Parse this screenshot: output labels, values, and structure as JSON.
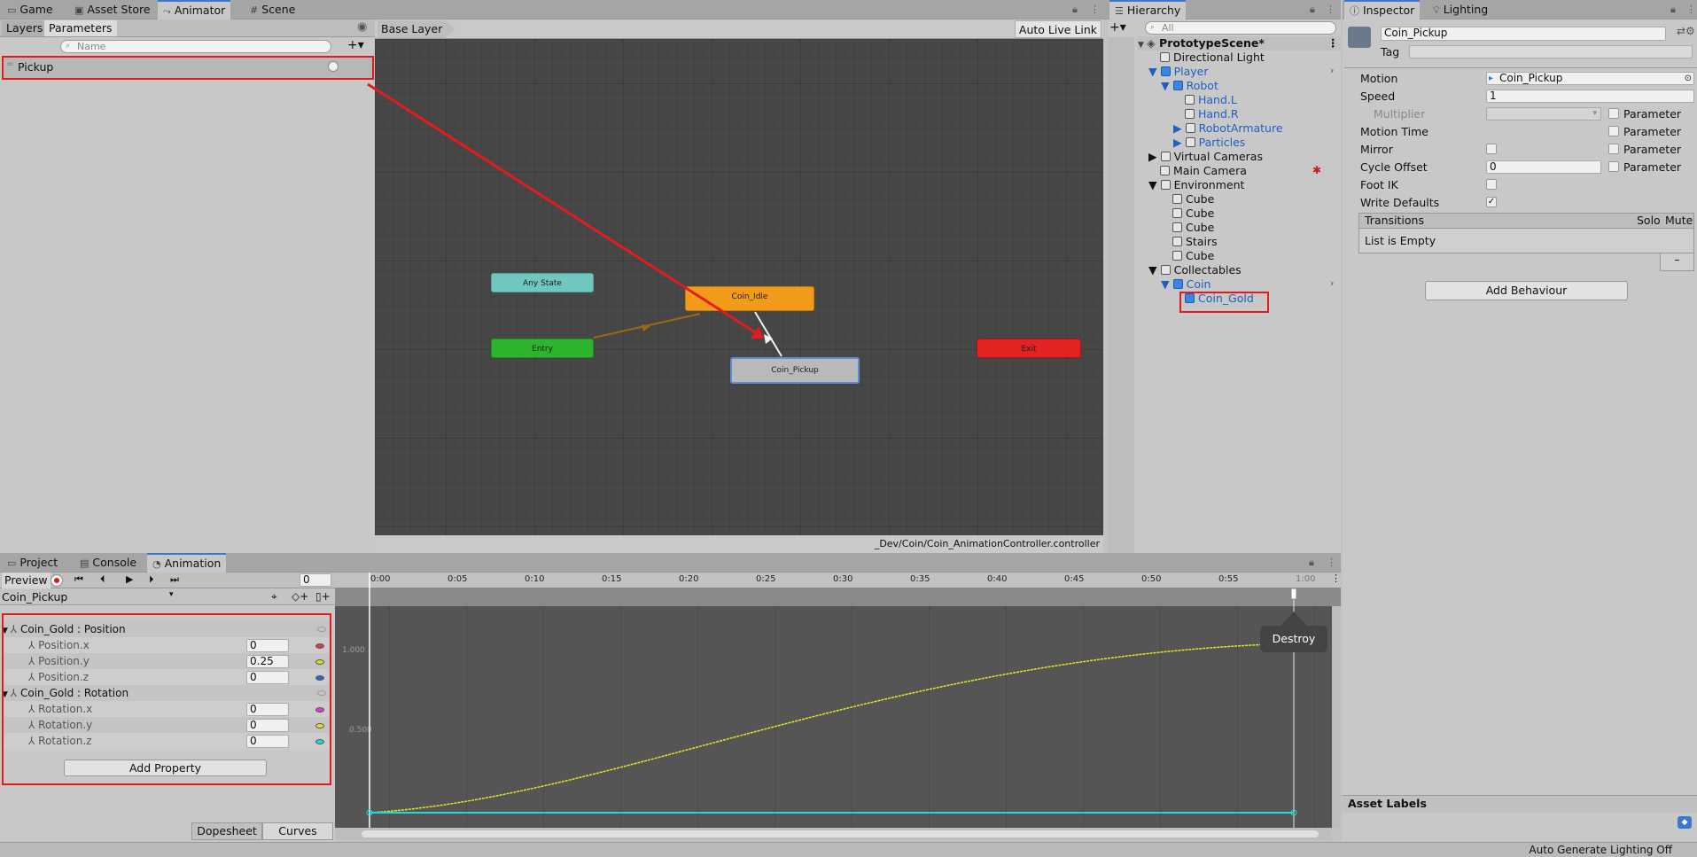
{
  "top_tabs": {
    "left": [
      {
        "label": "Game",
        "icon": "gamepad-icon"
      },
      {
        "label": "Asset Store",
        "icon": "store-icon"
      },
      {
        "label": "Animator",
        "icon": "animator-icon"
      },
      {
        "label": "Scene",
        "icon": "grid-icon"
      }
    ],
    "hierarchy_tab": "Hierarchy",
    "inspector_tab": "Inspector",
    "lighting_tab": "Lighting"
  },
  "animator": {
    "layers_tab": "Layers",
    "parameters_tab": "Parameters",
    "search_placeholder": "Name",
    "param": "Pickup",
    "breadcrumb": "Base Layer",
    "live_link": "Auto Live Link",
    "path": "_Dev/Coin/Coin_AnimationController.controller",
    "nodes": {
      "any": "Any State",
      "entry": "Entry",
      "idle": "Coin_Idle",
      "pickup": "Coin_Pickup",
      "exit": "Exit"
    }
  },
  "hierarchy": {
    "search_placeholder": "All",
    "scene": "PrototypeScene*",
    "items": [
      "Directional Light",
      "Player",
      "Robot",
      "Hand.L",
      "Hand.R",
      "RobotArmature",
      "Particles",
      "Virtual Cameras",
      "Main Camera",
      "Environment",
      "Cube",
      "Cube",
      "Cube",
      "Stairs",
      "Cube",
      "Collectables",
      "Coin",
      "Coin_Gold"
    ]
  },
  "inspector": {
    "name": "Coin_Pickup",
    "tag_label": "Tag",
    "motion_label": "Motion",
    "motion_value": "Coin_Pickup",
    "speed_label": "Speed",
    "speed_value": "1",
    "multiplier_label": "Multiplier",
    "motion_time_label": "Motion Time",
    "mirror_label": "Mirror",
    "cycle_offset_label": "Cycle Offset",
    "cycle_offset_value": "0",
    "foot_ik_label": "Foot IK",
    "write_defaults_label": "Write Defaults",
    "parameter_label": "Parameter",
    "transitions_label": "Transitions",
    "solo": "Solo",
    "mute": "Mute",
    "empty": "List is Empty",
    "add_behaviour": "Add Behaviour",
    "asset_labels": "Asset Labels"
  },
  "bottom_tabs": [
    {
      "label": "Project",
      "icon": "folder-icon"
    },
    {
      "label": "Console",
      "icon": "console-icon"
    },
    {
      "label": "Animation",
      "icon": "clock-icon"
    }
  ],
  "animation": {
    "preview": "Preview",
    "frame": "0",
    "clip": "Coin_Pickup",
    "groups": [
      {
        "label": "Coin_Gold : Position",
        "props": [
          {
            "label": "Position.x",
            "value": "0",
            "color": "#e03a3a"
          },
          {
            "label": "Position.y",
            "value": "0.25",
            "color": "#d8d820"
          },
          {
            "label": "Position.z",
            "value": "0",
            "color": "#3060e0"
          }
        ]
      },
      {
        "label": "Coin_Gold : Rotation",
        "props": [
          {
            "label": "Rotation.x",
            "value": "0",
            "color": "#d83ad8"
          },
          {
            "label": "Rotation.y",
            "value": "0",
            "color": "#e0e020"
          },
          {
            "label": "Rotation.z",
            "value": "0",
            "color": "#20d8d8"
          }
        ]
      }
    ],
    "add_property": "Add Property",
    "dopesheet": "Dopesheet",
    "curves": "Curves",
    "event": "Destroy",
    "ticks": [
      "0:00",
      "0:05",
      "0:10",
      "0:15",
      "0:20",
      "0:25",
      "0:30",
      "0:35",
      "0:40",
      "0:45",
      "0:50",
      "0:55",
      "1:00"
    ],
    "y_labels": [
      "1.000",
      "0.500"
    ]
  },
  "status": "Auto Generate Lighting Off"
}
